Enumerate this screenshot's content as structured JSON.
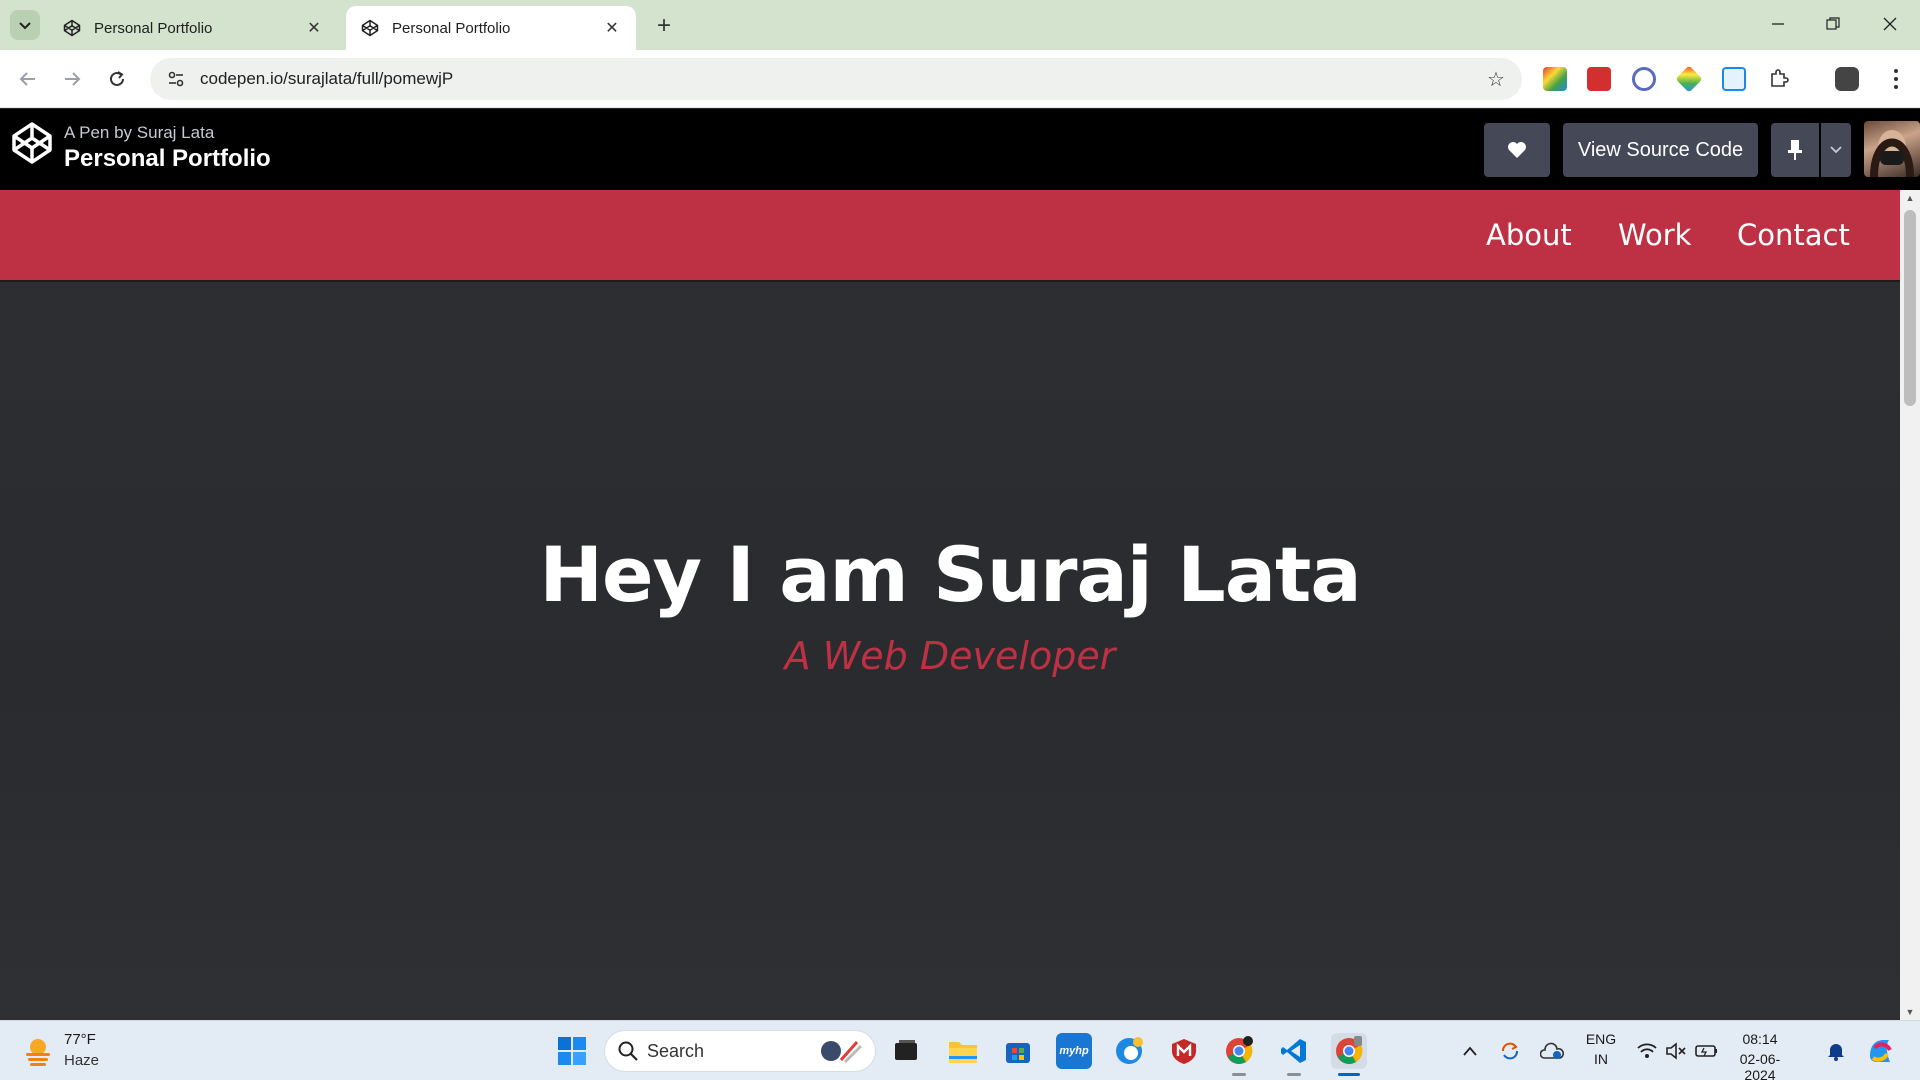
{
  "browser": {
    "tabs": [
      {
        "title": "Personal Portfolio",
        "active": false
      },
      {
        "title": "Personal Portfolio",
        "active": true
      }
    ],
    "url": "codepen.io/surajlata/full/pomewjP"
  },
  "codepen": {
    "author": "A Pen by Suraj Lata",
    "title": "Personal Portfolio",
    "view_source_label": "View Source Code"
  },
  "site": {
    "nav": [
      "About",
      "Work",
      "Contact"
    ],
    "hero_title": "Hey I am Suraj Lata",
    "hero_subtitle": "A Web Developer",
    "colors": {
      "accent": "#be3144",
      "background": "#2b2c2f"
    }
  },
  "taskbar": {
    "weather_temp": "77°F",
    "weather_condition": "Haze",
    "search_label": "Search",
    "language": "ENG",
    "region": "IN",
    "time": "08:14",
    "date": "02-06-2024"
  }
}
